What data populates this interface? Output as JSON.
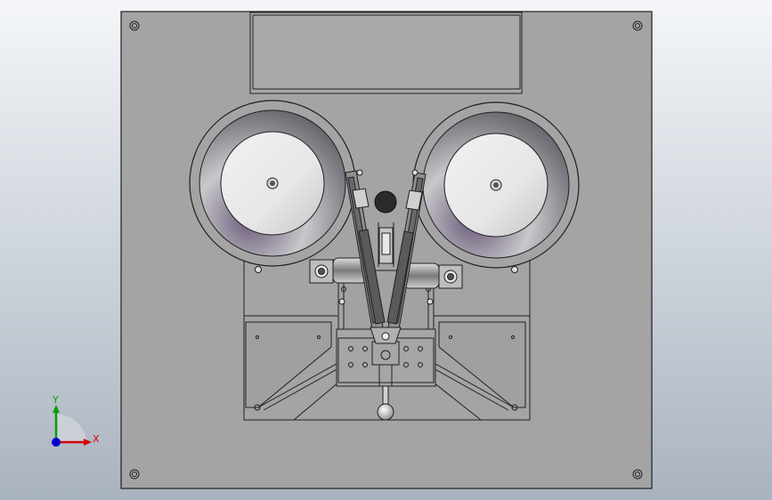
{
  "triad": {
    "x_label": "X",
    "y_label": "Y",
    "x_color": "#d40000",
    "y_color": "#00a000",
    "z_color": "#0000cc"
  },
  "colors": {
    "background_top": "#f4f6f9",
    "background_bottom": "#a9b3bf",
    "plate": "#a4a4a4",
    "edge": "#202020"
  }
}
